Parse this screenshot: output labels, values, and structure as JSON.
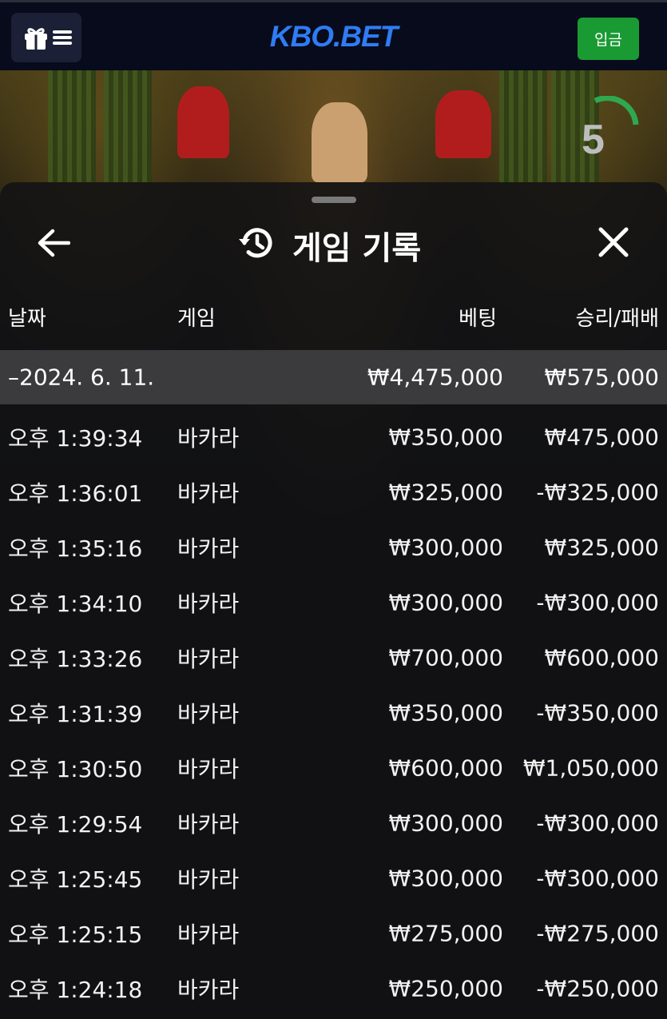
{
  "header": {
    "logo_text": "KBO.BET",
    "deposit_label": "입금"
  },
  "game_stream": {
    "countdown": "5"
  },
  "panel": {
    "title": "게임 기록",
    "columns": {
      "date": "날짜",
      "game": "게임",
      "bet": "베팅",
      "win_loss": "승리/패배"
    },
    "summary": {
      "date": "–2024. 6. 11.",
      "bet": "₩4,475,000",
      "win_loss": "₩575,000"
    },
    "rows": [
      {
        "time": "오후 1:39:34",
        "game": "바카라",
        "bet": "₩350,000",
        "result": "₩475,000"
      },
      {
        "time": "오후 1:36:01",
        "game": "바카라",
        "bet": "₩325,000",
        "result": "-₩325,000"
      },
      {
        "time": "오후 1:35:16",
        "game": "바카라",
        "bet": "₩300,000",
        "result": "₩325,000"
      },
      {
        "time": "오후 1:34:10",
        "game": "바카라",
        "bet": "₩300,000",
        "result": "-₩300,000"
      },
      {
        "time": "오후 1:33:26",
        "game": "바카라",
        "bet": "₩700,000",
        "result": "₩600,000"
      },
      {
        "time": "오후 1:31:39",
        "game": "바카라",
        "bet": "₩350,000",
        "result": "-₩350,000"
      },
      {
        "time": "오후 1:30:50",
        "game": "바카라",
        "bet": "₩600,000",
        "result": "₩1,050,000"
      },
      {
        "time": "오후 1:29:54",
        "game": "바카라",
        "bet": "₩300,000",
        "result": "-₩300,000"
      },
      {
        "time": "오후 1:25:45",
        "game": "바카라",
        "bet": "₩300,000",
        "result": "-₩300,000"
      },
      {
        "time": "오후 1:25:15",
        "game": "바카라",
        "bet": "₩275,000",
        "result": "-₩275,000"
      },
      {
        "time": "오후 1:24:18",
        "game": "바카라",
        "bet": "₩250,000",
        "result": "-₩250,000"
      }
    ]
  },
  "colors": {
    "accent_blue": "#2f7cf3",
    "deposit_green": "#1a9a33",
    "countdown_green": "#2fa84f",
    "summary_row_bg": "#3b3b3e"
  },
  "icons": {
    "menu": [
      "gift-icon",
      "hamburger-icon"
    ],
    "panel": [
      "back-arrow-icon",
      "history-icon",
      "close-icon"
    ]
  }
}
